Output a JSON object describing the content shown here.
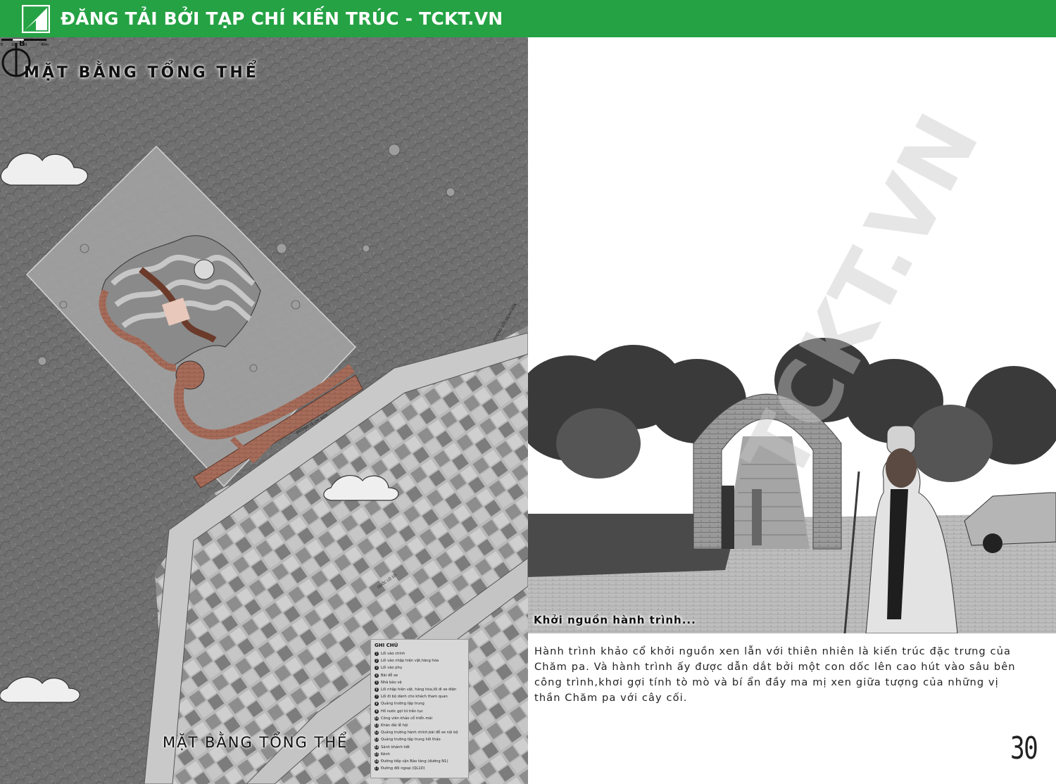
{
  "banner": {
    "title": "ĐĂNG TẢI BỞI TẠP CHÍ KIẾN TRÚC - TCKT.VN",
    "background_color": "#25a244",
    "logo_icon": "tckt-logo-icon"
  },
  "plan": {
    "heading": "MẶT BẰNG TỔNG THỂ",
    "subheading": "MẶT BẰNG TỔNG THỂ",
    "road_labels": [
      "ĐƯỜNG SỐT ĐỆNH HÒA",
      "ĐƯỜNG LÊ CH. MỐT",
      "QUỐC LỘ 1D"
    ],
    "legend": {
      "title": "GHI CHÚ",
      "items": [
        {
          "num": "1",
          "label": "Lối vào chính"
        },
        {
          "num": "2",
          "label": "Lối vào nhập hiện vật,hàng hóa"
        },
        {
          "num": "3",
          "label": "Lối vào phụ"
        },
        {
          "num": "4",
          "label": "Bãi đỗ xe"
        },
        {
          "num": "5",
          "label": "Nhà bảo vệ"
        },
        {
          "num": "6",
          "label": "Lối nhập hiện vật, hàng hóa,lối đi xe điện"
        },
        {
          "num": "7",
          "label": "Lối đi bộ dành cho khách tham quan"
        },
        {
          "num": "8",
          "label": "Quảng trường tập trung"
        },
        {
          "num": "9",
          "label": "Hồ nước gợi tứ trần tục"
        },
        {
          "num": "10",
          "label": "Công viên khảo cổ triển mãi"
        },
        {
          "num": "11",
          "label": "Khán đài lễ hội"
        },
        {
          "num": "12",
          "label": "Quảng trường hành chính,bãi đỗ xe nội bộ"
        },
        {
          "num": "13",
          "label": "Quảng trường tập trung hồi thảo"
        },
        {
          "num": "14",
          "label": "Sảnh khánh tiết"
        },
        {
          "num": "15",
          "label": "Kênh"
        },
        {
          "num": "16",
          "label": "Đường tiếp cận Bảo tàng (đường N1)"
        },
        {
          "num": "17",
          "label": "Đường đối ngoại (QL1D)"
        }
      ]
    },
    "compass_letter": "B",
    "scale_labels": [
      "0",
      "10",
      "20",
      "40m"
    ]
  },
  "photo": {
    "caption": "Khởi nguồn hành trình...",
    "watermark": "TCKT.VN"
  },
  "body_text": "Hành trình khảo cổ khởi nguồn xen lẫn với thiên nhiên là kiến trúc đặc trưng của Chăm pa. Và hành trình ấy được dẫn dắt bởi một con dốc lên cao hút vào sâu bên công trình,khơi gợi tính tò mò và bí ẩn đầy ma mị xen giữa tượng của những vị thần Chăm pa với cây cối.",
  "page_number": "30"
}
